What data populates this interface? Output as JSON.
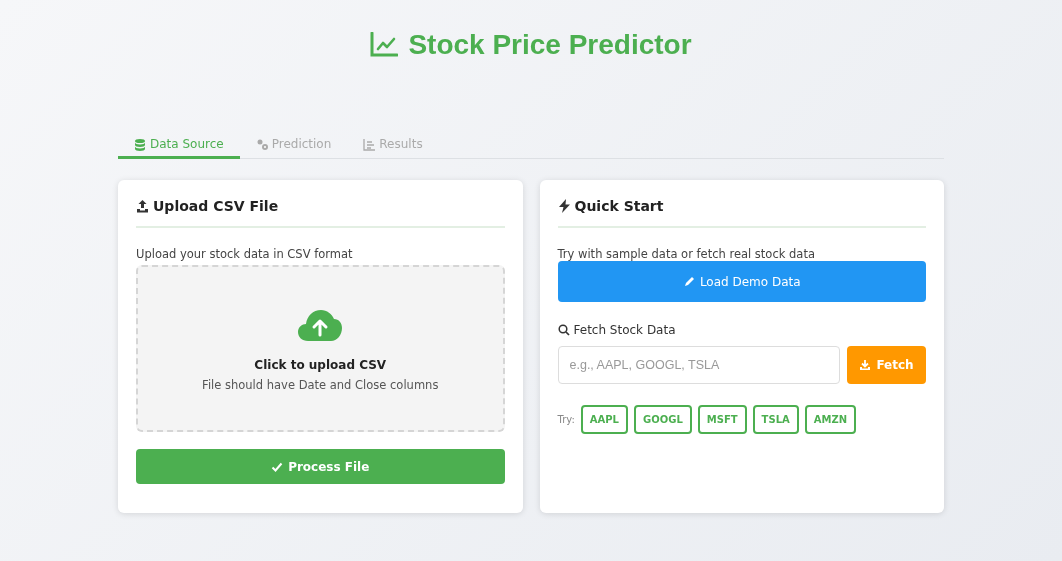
{
  "title": "Stock Price Predictor",
  "tabs": [
    {
      "label": "Data Source",
      "selected": true
    },
    {
      "label": "Prediction",
      "selected": false
    },
    {
      "label": "Results",
      "selected": false
    }
  ],
  "upload_card": {
    "heading": "Upload CSV File",
    "description": "Upload your stock data in CSV format",
    "dropzone": {
      "title": "Click to upload CSV",
      "hint": "File should have Date and Close columns"
    },
    "button": "Process File"
  },
  "quick_start_card": {
    "heading": "Quick Start",
    "description": "Try with sample data or fetch real stock data",
    "demo_button": "Load Demo Data",
    "fetch_label": "Fetch Stock Data",
    "fetch_field": {
      "placeholder": "e.g., AAPL, GOOGL, TSLA"
    },
    "fetch_button": "Fetch",
    "try_label": "Try:",
    "tickers": [
      "AAPL",
      "GOOGL",
      "MSFT",
      "TSLA",
      "AMZN"
    ]
  }
}
